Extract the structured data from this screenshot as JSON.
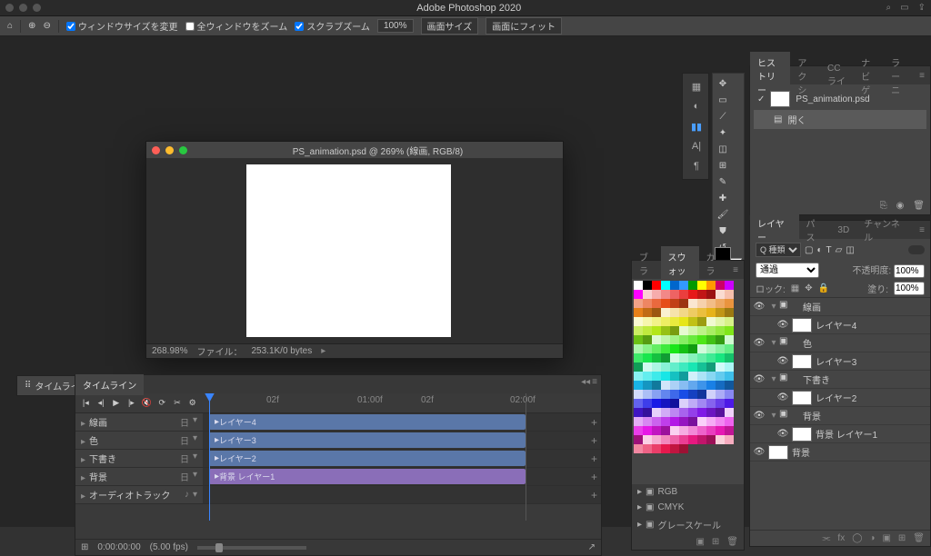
{
  "app": {
    "title": "Adobe Photoshop 2020"
  },
  "optionbar": {
    "resize_windows": "ウィンドウサイズを変更",
    "zoom_all": "全ウィンドウをズーム",
    "scrubby": "スクラブズーム",
    "zoom_pct": "100%",
    "fit_screen": "画面サイズ",
    "fit_window": "画面にフィット"
  },
  "document": {
    "title": "PS_animation.psd @ 269% (線画, RGB/8)",
    "zoom": "268.98%",
    "filesize_label": "ファイル：",
    "filesize": "253.1K/0 bytes"
  },
  "timeline_tab": "タイムライン",
  "timeline": {
    "title": "タイムライン",
    "ruler": [
      "",
      "02f",
      "01:00f",
      "02f",
      "02:00f"
    ],
    "tracks": [
      {
        "label": "線画",
        "clip": "レイヤー4",
        "color": "blue"
      },
      {
        "label": "色",
        "clip": "レイヤー3",
        "color": "blue"
      },
      {
        "label": "下書き",
        "clip": "レイヤー2",
        "color": "blue"
      },
      {
        "label": "背景",
        "clip": "背景  レイヤー1",
        "color": "purple"
      }
    ],
    "audio": "オーディオトラック",
    "timecode": "0:00:00:00",
    "fps": "(5.00 fps)"
  },
  "history": {
    "tabs": [
      "ヒストリー",
      "アクシ",
      "CC ライ",
      "ナビゲ",
      "ラーニ"
    ],
    "items": [
      {
        "label": "PS_animation.psd",
        "sel": false
      },
      {
        "label": "開く",
        "sel": true
      }
    ]
  },
  "swatches": {
    "tabs": [
      "ブラシ",
      "スウォッチ",
      "カラー"
    ],
    "folders": [
      "RGB",
      "CMYK",
      "グレースケール"
    ]
  },
  "layers": {
    "tabs": [
      "レイヤー",
      "パス",
      "3D",
      "チャンネル"
    ],
    "kind_label": "Q 種類",
    "blend": "通過",
    "opacity_label": "不透明度:",
    "opacity": "100%",
    "lock_label": "ロック:",
    "fill_label": "塗り:",
    "fill": "100%",
    "items": [
      {
        "type": "group",
        "label": "線画"
      },
      {
        "type": "layer",
        "label": "レイヤー4",
        "child": true
      },
      {
        "type": "group",
        "label": "色"
      },
      {
        "type": "layer",
        "label": "レイヤー3",
        "child": true
      },
      {
        "type": "group",
        "label": "下書き"
      },
      {
        "type": "layer",
        "label": "レイヤー2",
        "child": true
      },
      {
        "type": "group",
        "label": "背景"
      },
      {
        "type": "layer",
        "label": "背景  レイヤー1",
        "child": true
      },
      {
        "type": "layer",
        "label": "背景",
        "child": false
      }
    ]
  }
}
